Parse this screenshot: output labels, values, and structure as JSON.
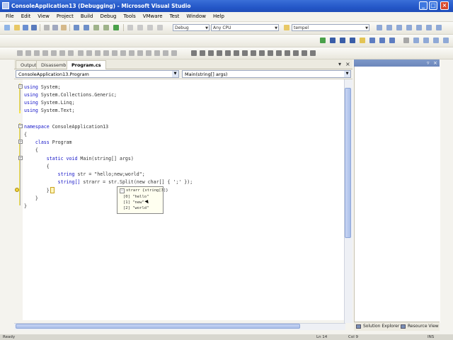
{
  "window": {
    "title": "ConsoleApplication13 (Debugging) - Microsoft Visual Studio",
    "minimize_label": "_",
    "maximize_label": "□",
    "close_label": "×"
  },
  "menu": [
    "File",
    "Edit",
    "View",
    "Project",
    "Build",
    "Debug",
    "Tools",
    "VMware",
    "Test",
    "Window",
    "Help"
  ],
  "toolbar": {
    "config_combo": "Debug",
    "platform_combo": "Any CPU",
    "find_combo": "tempel"
  },
  "doc_tabs": {
    "tabs": [
      "Output",
      "Disassembly",
      "Program.cs"
    ],
    "active": "Program.cs",
    "dropdown_label": "▾",
    "close_label": "×"
  },
  "nav": {
    "type_combo": "ConsoleApplication13.Program",
    "member_combo": "Main(string[] args)"
  },
  "code": {
    "lines": [
      {
        "indent": "",
        "kw": "using",
        "rest": " System;"
      },
      {
        "indent": "",
        "kw": "using",
        "rest": " System.Collections.Generic;"
      },
      {
        "indent": "",
        "kw": "using",
        "rest": " System.Linq;"
      },
      {
        "indent": "",
        "kw": "using",
        "rest": " System.Text;"
      },
      {
        "indent": "",
        "kw": "",
        "rest": ""
      },
      {
        "indent": "",
        "kw": "namespace",
        "rest": " ConsoleApplication13"
      },
      {
        "indent": "",
        "kw": "",
        "rest": "{"
      },
      {
        "indent": "    ",
        "kw": "class",
        "rest": " Program"
      },
      {
        "indent": "    ",
        "kw": "",
        "rest": "{"
      },
      {
        "indent": "        ",
        "kw": "static void",
        "rest": " Main(string[] args)"
      },
      {
        "indent": "        ",
        "kw": "",
        "rest": "{"
      },
      {
        "indent": "            ",
        "kw": "string",
        "rest": " str = \"hello;new;world\";"
      },
      {
        "indent": "            ",
        "kw": "string[]",
        "rest": " strarr = str.Split(new char[] { ';' });"
      },
      {
        "indent": "        ",
        "kw": "",
        "rest": "}"
      },
      {
        "indent": "    ",
        "kw": "",
        "rest": "}"
      },
      {
        "indent": "",
        "kw": "",
        "rest": "}"
      }
    ]
  },
  "datatip": {
    "header": "strarr {string[3]}",
    "items": [
      "[0] \"hello\"",
      "[1] \"new\"",
      "[2] \"world\""
    ]
  },
  "right_panel": {
    "tabs": [
      "Solution Explorer",
      "Resource View"
    ]
  },
  "status": {
    "left": "Ready",
    "line": "Ln 14",
    "col": "Col 9",
    "ins": "INS"
  }
}
